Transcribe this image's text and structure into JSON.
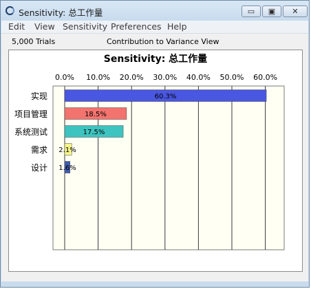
{
  "window": {
    "title": "Sensitivity: 总工作量",
    "min_glyph": "▭",
    "max_glyph": "▣",
    "close_glyph": "✕"
  },
  "menu": [
    "Edit",
    "View",
    "Sensitivity",
    "Preferences",
    "Help"
  ],
  "status": {
    "trials": "5,000 Trials",
    "view_name": "Contribution to Variance View"
  },
  "chart_data": {
    "type": "bar",
    "orientation": "horizontal",
    "title": "Sensitivity: 总工作量",
    "categories": [
      "实现",
      "项目管理",
      "系统测试",
      "需求",
      "设计"
    ],
    "values": [
      60.3,
      18.5,
      17.5,
      2.1,
      1.6
    ],
    "labels": [
      "60.3%",
      "18.5%",
      "17.5%",
      "2.1%",
      "1.6%"
    ],
    "colors": [
      "#4a57e0",
      "#f3736e",
      "#3ec4c0",
      "#f5f58a",
      "#3f5bb0"
    ],
    "xticks": [
      0,
      10,
      20,
      30,
      40,
      50,
      60
    ],
    "xtick_labels": [
      "0.0%",
      "10.0%",
      "20.0%",
      "30.0%",
      "40.0%",
      "50.0%",
      "60.0%"
    ],
    "xlim": [
      0,
      60
    ],
    "grid": true,
    "plot_background": "#fffff4"
  }
}
